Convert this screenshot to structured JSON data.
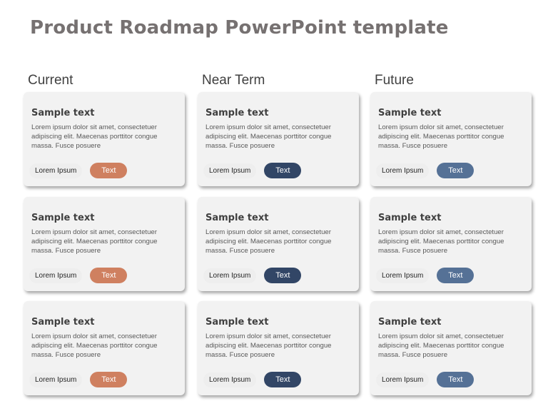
{
  "title": "Product Roadmap PowerPoint template",
  "colors": {
    "current": "#cf8060",
    "near_term": "#324666",
    "future": "#557196"
  },
  "columns": [
    {
      "header": "Current",
      "cards": [
        {
          "title": "Sample text",
          "body": "Lorem ipsum dolor sit amet, consectetuer adipiscing elit. Maecenas porttitor congue massa. Fusce posuere",
          "label": "Lorem Ipsum",
          "button": "Text"
        },
        {
          "title": "Sample text",
          "body": "Lorem ipsum dolor sit amet, consectetuer adipiscing elit. Maecenas porttitor congue massa. Fusce posuere",
          "label": "Lorem Ipsum",
          "button": "Text"
        },
        {
          "title": "Sample text",
          "body": "Lorem ipsum dolor sit amet, consectetuer adipiscing elit. Maecenas porttitor congue massa. Fusce posuere",
          "label": "Lorem Ipsum",
          "button": "Text"
        }
      ]
    },
    {
      "header": "Near Term",
      "cards": [
        {
          "title": "Sample text",
          "body": "Lorem ipsum dolor sit amet, consectetuer adipiscing elit. Maecenas porttitor congue massa. Fusce posuere",
          "label": "Lorem Ipsum",
          "button": "Text"
        },
        {
          "title": "Sample text",
          "body": "Lorem ipsum dolor sit amet, consectetuer adipiscing elit. Maecenas porttitor congue massa. Fusce posuere",
          "label": "Lorem Ipsum",
          "button": "Text"
        },
        {
          "title": "Sample text",
          "body": "Lorem ipsum dolor sit amet, consectetuer adipiscing elit. Maecenas porttitor congue massa. Fusce posuere",
          "label": "Lorem Ipsum",
          "button": "Text"
        }
      ]
    },
    {
      "header": "Future",
      "cards": [
        {
          "title": "Sample text",
          "body": "Lorem ipsum dolor sit amet, consectetuer adipiscing elit. Maecenas porttitor congue massa. Fusce posuere",
          "label": "Lorem Ipsum",
          "button": "Text"
        },
        {
          "title": "Sample text",
          "body": "Lorem ipsum dolor sit amet, consectetuer adipiscing elit. Maecenas porttitor congue massa. Fusce posuere",
          "label": "Lorem Ipsum",
          "button": "Text"
        },
        {
          "title": "Sample text",
          "body": "Lorem ipsum dolor sit amet, consectetuer adipiscing elit. Maecenas porttitor congue massa. Fusce posuere",
          "label": "Lorem Ipsum",
          "button": "Text"
        }
      ]
    }
  ]
}
